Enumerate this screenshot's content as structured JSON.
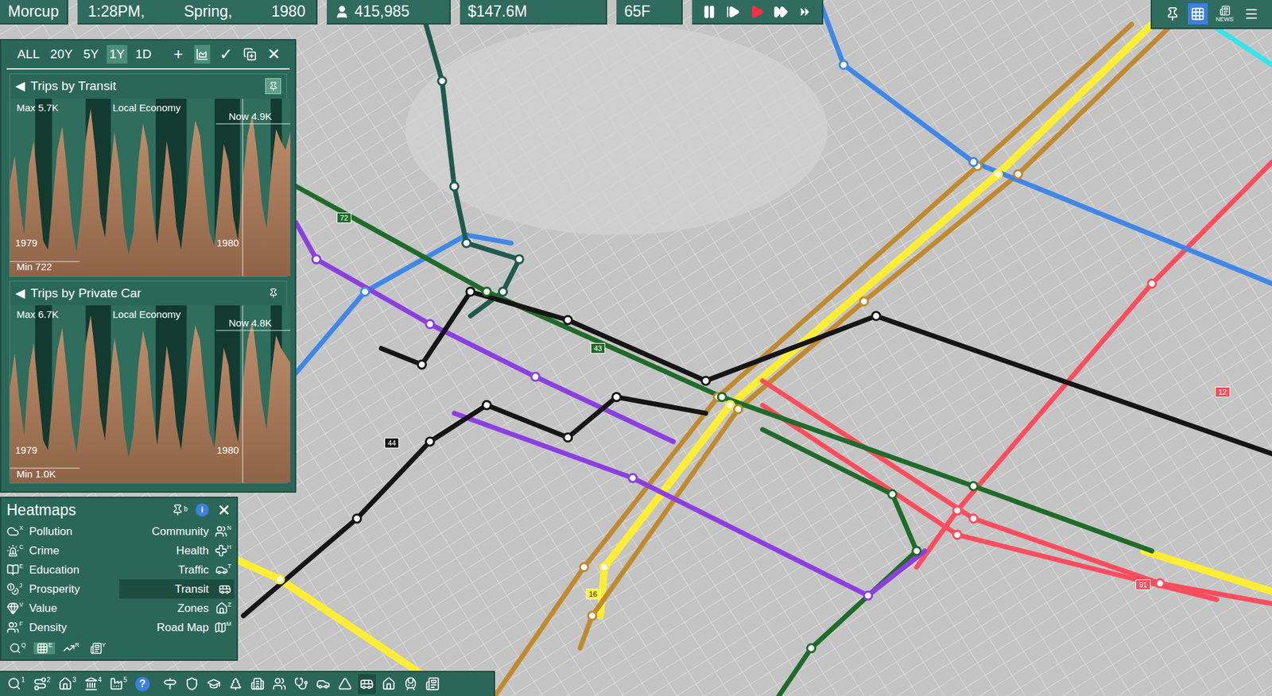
{
  "top_bar": {
    "city": "Morcup",
    "time": "1:28PM,",
    "season": "Spring,",
    "year": "1980",
    "population": "415,985",
    "money": "$147.6M",
    "temperature": "65F",
    "speeds": [
      {
        "name": "pause",
        "active": false
      },
      {
        "name": "step",
        "active": false
      },
      {
        "name": "play",
        "active": true
      },
      {
        "name": "fast",
        "active": false
      },
      {
        "name": "fastest",
        "active": false
      }
    ],
    "tools": [
      {
        "name": "pin",
        "label": "",
        "selected": false
      },
      {
        "name": "grid",
        "label": "",
        "selected": true
      },
      {
        "name": "news",
        "label": "NEWS",
        "selected": false
      },
      {
        "name": "menu",
        "label": "",
        "selected": false
      }
    ]
  },
  "chart_window": {
    "ranges": [
      {
        "label": "ALL",
        "selected": false
      },
      {
        "label": "20Y",
        "selected": false
      },
      {
        "label": "5Y",
        "selected": false
      },
      {
        "label": "1Y",
        "selected": true
      },
      {
        "label": "1D",
        "selected": false
      }
    ],
    "actions": [
      {
        "label": "+",
        "kind": "text",
        "selected": false
      },
      {
        "label": "",
        "kind": "chart",
        "selected": true
      },
      {
        "label": "✓",
        "kind": "text",
        "selected": false
      },
      {
        "label": "",
        "kind": "addchart",
        "selected": false
      },
      {
        "label": "✕",
        "kind": "text",
        "selected": false
      }
    ],
    "charts": [
      {
        "arrow": "◀",
        "title": "Trips by Transit",
        "pinned": true,
        "max": "Max  5.7K",
        "scope": "Local Economy",
        "now": "Now  4.9K",
        "min": "Min  722",
        "start": "1979",
        "end": "1980",
        "max_value": 5700,
        "values": [
          3200,
          4100,
          2500,
          1400,
          3800,
          4600,
          2900,
          1200,
          900,
          2600,
          4300,
          5100,
          3600,
          1800,
          800,
          2200,
          4700,
          5700,
          4200,
          2100,
          1300,
          3400,
          4900,
          3800,
          1600,
          722,
          1500,
          3900,
          5200,
          4400,
          2300,
          1100,
          2800,
          4600,
          3500,
          1700,
          900,
          2400,
          4100,
          5300,
          4800,
          3000,
          1500,
          1000,
          2700,
          4500,
          3900,
          2000,
          1200,
          3300,
          4800,
          5500,
          4200,
          2500,
          1600,
          3600,
          5000,
          4600,
          4300,
          4900
        ]
      },
      {
        "arrow": "◀",
        "title": "Trips by Private Car",
        "pinned": false,
        "max": "Max  6.7K",
        "scope": "Local Economy",
        "now": "Now  4.8K",
        "min": "Min  1.0K",
        "start": "1979",
        "end": "1980",
        "max_value": 6700,
        "values": [
          3800,
          5200,
          3300,
          1900,
          4500,
          5600,
          3600,
          1700,
          1300,
          3400,
          5300,
          6200,
          4400,
          2300,
          1200,
          2900,
          5600,
          6700,
          5000,
          2700,
          1700,
          4100,
          5800,
          4600,
          2100,
          1000,
          2000,
          4700,
          6100,
          5200,
          3000,
          1500,
          3500,
          5500,
          4300,
          2300,
          1300,
          3100,
          5000,
          6300,
          5700,
          3700,
          2000,
          1400,
          3400,
          5400,
          4700,
          2600,
          1600,
          4000,
          5700,
          6500,
          5000,
          3200,
          2100,
          4400,
          5900,
          5400,
          5100,
          4800
        ]
      }
    ]
  },
  "heatmaps": {
    "title": "Heatmaps",
    "pin_key": "b",
    "info": "i",
    "items": [
      {
        "label": "Pollution",
        "key": "X",
        "selected": false
      },
      {
        "label": "Community",
        "key": "N",
        "selected": false
      },
      {
        "label": "Crime",
        "key": "C",
        "selected": false
      },
      {
        "label": "Health",
        "key": "H",
        "selected": false
      },
      {
        "label": "Education",
        "key": "E",
        "selected": false
      },
      {
        "label": "Traffic",
        "key": "T",
        "selected": false
      },
      {
        "label": "Prosperity",
        "key": "J",
        "selected": false
      },
      {
        "label": "Transit",
        "key": "",
        "selected": true
      },
      {
        "label": "Value",
        "key": "V",
        "selected": false
      },
      {
        "label": "Zones",
        "key": "Z",
        "selected": false
      },
      {
        "label": "Density",
        "key": "F",
        "selected": false
      },
      {
        "label": "Road  Map",
        "key": "M",
        "selected": false
      }
    ],
    "tools": [
      {
        "key": "Q",
        "selected": false
      },
      {
        "key": "E",
        "selected": true
      },
      {
        "key": "R",
        "selected": false
      },
      {
        "key": "Y",
        "selected": false
      }
    ]
  },
  "toolbar": [
    {
      "key": "1",
      "label": "",
      "selected": false
    },
    {
      "key": "2",
      "label": "",
      "selected": false
    },
    {
      "key": "3",
      "label": "",
      "selected": false
    },
    {
      "key": "4",
      "label": "",
      "selected": false
    },
    {
      "key": "5",
      "label": "",
      "selected": false
    },
    {
      "key": "",
      "label": "?",
      "selected": false
    },
    {
      "key": "",
      "label": "",
      "selected": false
    },
    {
      "key": "",
      "label": "",
      "selected": false
    },
    {
      "key": "",
      "label": "",
      "selected": false
    },
    {
      "key": "",
      "label": "",
      "selected": false
    },
    {
      "key": "",
      "label": "",
      "selected": false
    },
    {
      "key": "",
      "label": "",
      "selected": false
    },
    {
      "key": "",
      "label": "",
      "selected": false
    },
    {
      "key": "",
      "label": "",
      "selected": false
    },
    {
      "key": "",
      "label": "",
      "selected": false
    },
    {
      "key": "",
      "label": "",
      "selected": true
    },
    {
      "key": "",
      "label": "",
      "selected": false
    },
    {
      "key": "",
      "label": "",
      "selected": false
    },
    {
      "key": "",
      "label": "",
      "selected": false
    }
  ],
  "map": {
    "routes": [
      {
        "color": "#ffee33"
      },
      {
        "color": "#c08a2e"
      },
      {
        "color": "#ff4d5e"
      },
      {
        "color": "#3f87e8"
      },
      {
        "color": "#1f5a4d"
      },
      {
        "color": "#1f6b2a"
      },
      {
        "color": "#8c3fe0"
      },
      {
        "color": "#151515"
      },
      {
        "color": "#33e6ee"
      }
    ],
    "labels": [
      {
        "text": "72",
        "color": "#1f6b2a"
      },
      {
        "text": "43",
        "color": "#1f6b2a"
      },
      {
        "text": "44",
        "color": "#151515"
      },
      {
        "text": "12",
        "color": "#ff4d5e"
      },
      {
        "text": "16",
        "color": "#ffee33"
      },
      {
        "text": "91",
        "color": "#ff4d5e"
      }
    ]
  }
}
